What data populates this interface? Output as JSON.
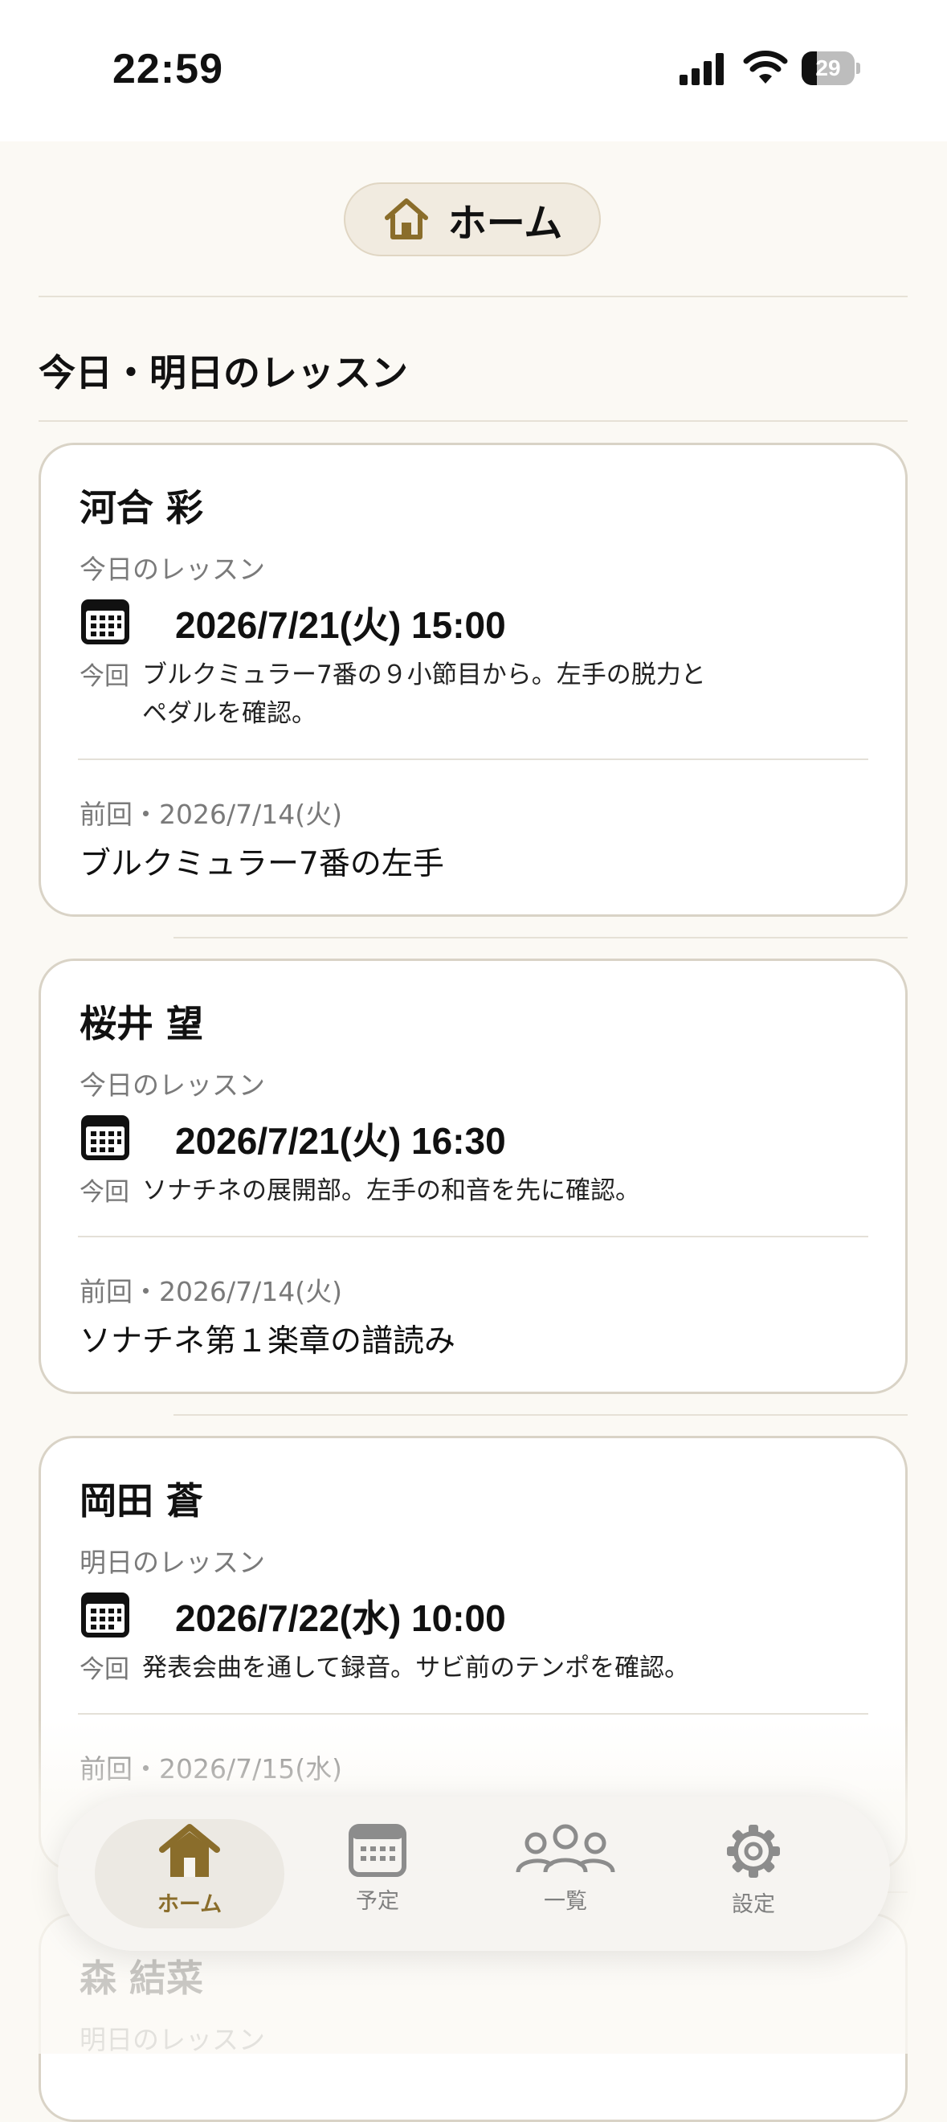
{
  "status_bar": {
    "time": "22:59",
    "battery_level": "29",
    "battery_fraction": 0.29
  },
  "header": {
    "title": "ホーム",
    "icon": "house-icon"
  },
  "section": {
    "title": "今日・明日のレッスン"
  },
  "colors": {
    "accent": "#8a6d2b",
    "background": "#fbf9f4",
    "card_border": "#d9d3c6",
    "muted_text": "#7a7a7a"
  },
  "lessons": [
    {
      "name": "河合 彩",
      "when_label": "今日のレッスン",
      "datetime": "2026/7/21(火) 15:00",
      "note_tag": "今回",
      "note_lines": [
        "ブルクミュラー7番の９小節目から。左手の脱力と",
        "ペダルを確認。"
      ],
      "prev_label": "前回・2026/7/14(火)",
      "prev_text": "ブルクミュラー7番の左手"
    },
    {
      "name": "桜井 望",
      "when_label": "今日のレッスン",
      "datetime": "2026/7/21(火) 16:30",
      "note_tag": "今回",
      "note_lines": [
        "ソナチネの展開部。左手の和音を先に確認。"
      ],
      "prev_label": "前回・2026/7/14(火)",
      "prev_text": "ソナチネ第１楽章の譜読み"
    },
    {
      "name": "岡田 蒼",
      "when_label": "明日のレッスン",
      "datetime": "2026/7/22(水) 10:00",
      "note_tag": "今回",
      "note_lines": [
        "発表会曲を通して録音。サビ前のテンポを確認。"
      ],
      "prev_label": "前回・2026/7/15(水)",
      "prev_text": ""
    },
    {
      "name": "森 結菜",
      "when_label": "明日のレッスン"
    }
  ],
  "tabs": [
    {
      "label": "ホーム",
      "icon": "house-icon",
      "active": true
    },
    {
      "label": "予定",
      "icon": "calendar-icon",
      "active": false
    },
    {
      "label": "一覧",
      "icon": "people-icon",
      "active": false
    },
    {
      "label": "設定",
      "icon": "gear-icon",
      "active": false
    }
  ]
}
